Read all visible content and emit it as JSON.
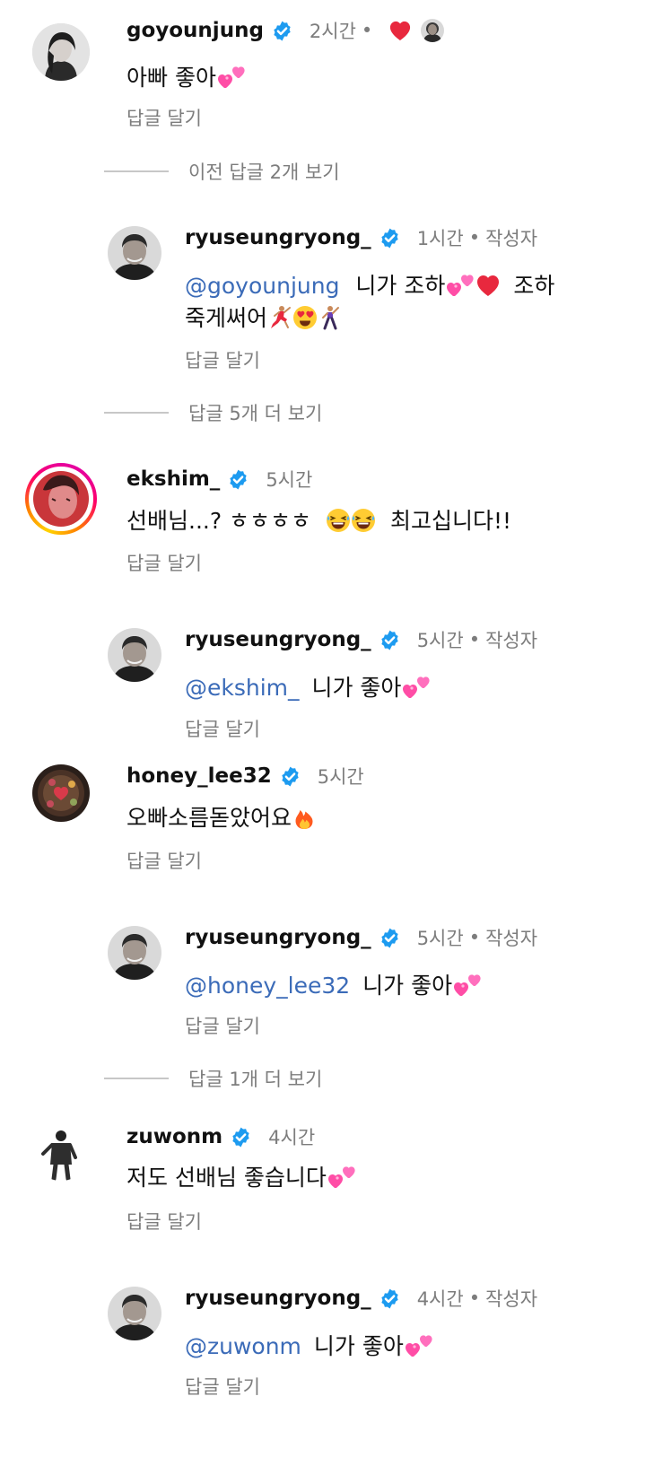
{
  "comments": [
    {
      "username": "goyounjung",
      "time": "2시간",
      "text": "아빠 좋아",
      "reply_label": "답글 달기",
      "view_replies": "이전 답글 2개 보기",
      "reply": {
        "username": "ryuseungryong_",
        "time": "1시간",
        "author_label": "작성자",
        "mention": "@goyounjung",
        "line1": "니가 조하",
        "line1b": "조하",
        "line2": "죽게써어",
        "reply_label": "답글 달기"
      },
      "more_replies": "답글 5개 더 보기"
    },
    {
      "username": "ekshim_",
      "time": "5시간",
      "text": "선배님...? ㅎㅎㅎㅎ",
      "text_after": "최고십니다!!",
      "reply_label": "답글 달기",
      "reply": {
        "username": "ryuseungryong_",
        "time": "5시간",
        "author_label": "작성자",
        "mention": "@ekshim_",
        "line1": "니가 좋아",
        "reply_label": "답글 달기"
      }
    },
    {
      "username": "honey_lee32",
      "time": "5시간",
      "text": "오빠소름돋았어요",
      "reply_label": "답글 달기",
      "reply": {
        "username": "ryuseungryong_",
        "time": "5시간",
        "author_label": "작성자",
        "mention": "@honey_lee32",
        "line1": "니가 좋아",
        "reply_label": "답글 달기"
      },
      "more_replies": "답글 1개 더 보기"
    },
    {
      "username": "zuwonm",
      "time": "4시간",
      "text": "저도 선배님 좋습니다",
      "reply_label": "답글 달기",
      "reply": {
        "username": "ryuseungryong_",
        "time": "4시간",
        "author_label": "작성자",
        "mention": "@zuwonm",
        "line1": "니가 좋아",
        "reply_label": "답글 달기"
      }
    }
  ],
  "dot": "•",
  "icons": {
    "verified": "verified-badge-icon",
    "liked_by_author": "heart-icon",
    "sparkling_heart": "two-hearts-emoji",
    "fire": "fire-emoji",
    "grin_sweat": "laughing-emoji",
    "heart_eyes": "heart-eyes-emoji",
    "dancer": "dancer-emoji",
    "man_dancing": "man-dancing-emoji",
    "red_heart": "red-heart-emoji"
  },
  "colors": {
    "mention": "#3b6bb8",
    "verified": "#1d9bf0",
    "muted": "#7d7d7d",
    "heart": "#e8283e",
    "pink_heart": "#ff4da6"
  }
}
